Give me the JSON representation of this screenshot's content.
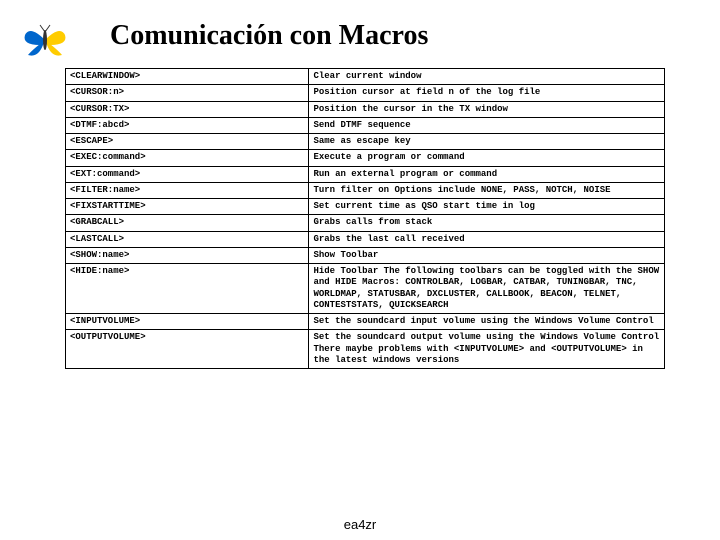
{
  "title": "Comunicación con Macros",
  "footer": "ea4zr",
  "rows": [
    {
      "cmd": "<CLEARWINDOW>",
      "desc": "Clear current window"
    },
    {
      "cmd": "<CURSOR:n>",
      "desc": "Position cursor at field n of the log file"
    },
    {
      "cmd": "<CURSOR:TX>",
      "desc": "Position the cursor in the TX window"
    },
    {
      "cmd": "<DTMF:abcd>",
      "desc": "Send DTMF sequence"
    },
    {
      "cmd": "<ESCAPE>",
      "desc": "Same as escape key"
    },
    {
      "cmd": "<EXEC:command>",
      "desc": "Execute a program or command"
    },
    {
      "cmd": "<EXT:command>",
      "desc": "Run an external program or command"
    },
    {
      "cmd": "<FILTER:name>",
      "desc": "Turn filter on\nOptions include NONE, PASS, NOTCH, NOISE"
    },
    {
      "cmd": "<FIXSTARTTIME>",
      "desc": "Set current time as QSO start time in log"
    },
    {
      "cmd": "<GRABCALL>",
      "desc": "Grabs calls from stack"
    },
    {
      "cmd": "<LASTCALL>",
      "desc": "Grabs the last call received"
    },
    {
      "cmd": "<SHOW:name>",
      "desc": "Show Toolbar"
    },
    {
      "cmd": "<HIDE:name>",
      "desc": "Hide Toolbar\nThe following toolbars can be toggled with the SHOW and HIDE Macros:\nCONTROLBAR, LOGBAR, CATBAR, TUNINGBAR, TNC, WORLDMAP, STATUSBAR, DXCLUSTER, CALLBOOK, BEACON, TELNET, CONTESTSTATS, QUICKSEARCH"
    },
    {
      "cmd": "<INPUTVOLUME>",
      "desc": "Set the soundcard input volume using the Windows Volume Control"
    },
    {
      "cmd": "<OUTPUTVOLUME>",
      "desc": "Set the soundcard output volume using the Windows Volume Control\nThere maybe problems with <INPUTVOLUME> and <OUTPUTVOLUME> in the latest windows versions"
    }
  ]
}
